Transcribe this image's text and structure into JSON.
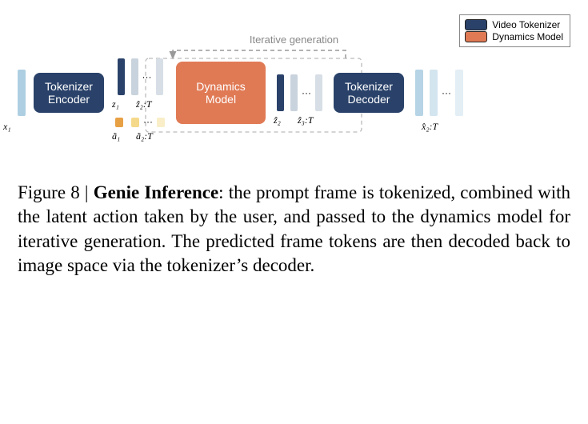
{
  "legend": {
    "video_tokenizer": "Video Tokenizer",
    "dynamics_model": "Dynamics Model"
  },
  "iter_label": "Iterative generation",
  "blocks": {
    "encoder_l1": "Tokenizer",
    "encoder_l2": "Encoder",
    "dynamics_l1": "Dynamics",
    "dynamics_l2": "Model",
    "decoder_l1": "Tokenizer",
    "decoder_l2": "Decoder"
  },
  "labels": {
    "x1": "x₁",
    "z1": "z₁",
    "zhat2T": "ẑ₂:T",
    "a1": "ã₁",
    "a2T": "ã₂:T",
    "zhat2": "ẑ₂",
    "zhat3T": "ẑ₃:T",
    "xhat2T": "x̂₂:T",
    "dots": "···"
  },
  "caption": {
    "fig_num": "Figure 8",
    "sep": " | ",
    "title": "Genie Inference",
    "body": ": the prompt frame is tokenized, combined with the latent action taken by the user, and passed to the dynamics model for iterative generation. The predicted frame tokens are then decoded back to image space via the tokenizer’s decoder."
  }
}
